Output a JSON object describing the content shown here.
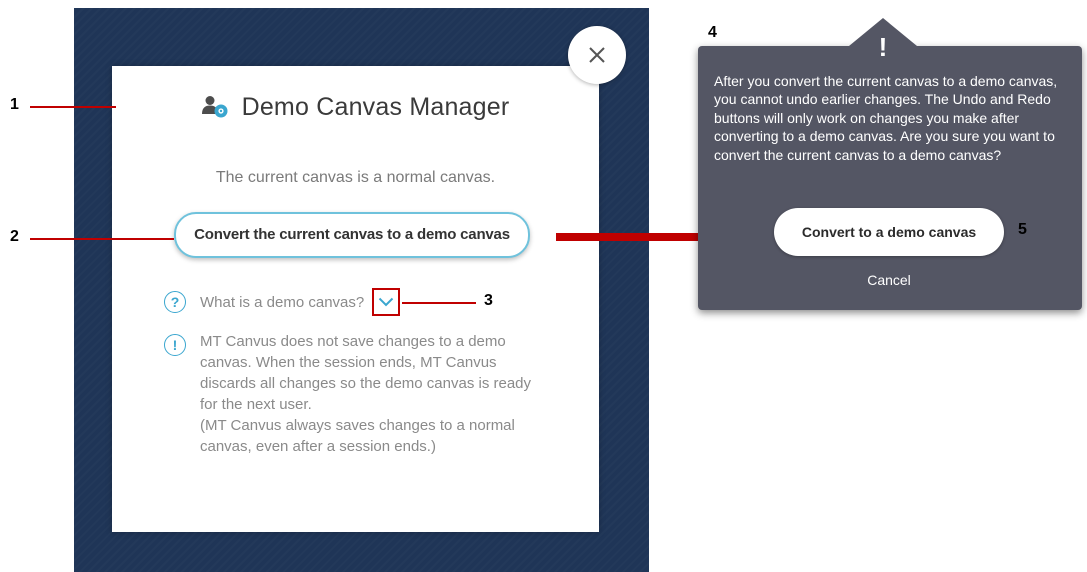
{
  "dialog": {
    "title": "Demo Canvas Manager",
    "subtitle": "The current canvas is a normal canvas.",
    "convert_button": "Convert the current canvas to a demo canvas",
    "faq_label": "What is a demo canvas?",
    "info_lines": [
      "MT Canvus does not save changes to a demo",
      "canvas. When the session ends, MT Canvus",
      "discards all changes so the demo canvas is ready",
      "for the next user.",
      "(MT Canvus always saves changes to a normal",
      "canvas, even after a session ends.)"
    ],
    "faq_icon_glyph": "?",
    "info_icon_glyph": "!"
  },
  "popover": {
    "exclaim_glyph": "!",
    "message_lines": [
      "After you convert the current canvas to a demo canvas,",
      "you cannot undo earlier changes. The Undo and Redo",
      "buttons will only work on changes you make after",
      "converting to a demo canvas. Are you sure you want to",
      "convert the current canvas to a demo canvas?"
    ],
    "confirm_button": "Convert to a demo canvas",
    "cancel_button": "Cancel"
  },
  "callouts": [
    "1",
    "2",
    "3",
    "4",
    "5"
  ],
  "icons": {
    "title": "user-settings-icon",
    "close": "close-icon",
    "faq": "question-circle-icon",
    "info": "exclamation-circle-icon",
    "expand": "chevron-down-icon",
    "popover_alert": "exclamation-icon"
  },
  "colors": {
    "canvas_background": "#1f3557",
    "accent_blue": "#3aa6cf",
    "callout_red": "#c00000",
    "popover_background": "#545664"
  }
}
